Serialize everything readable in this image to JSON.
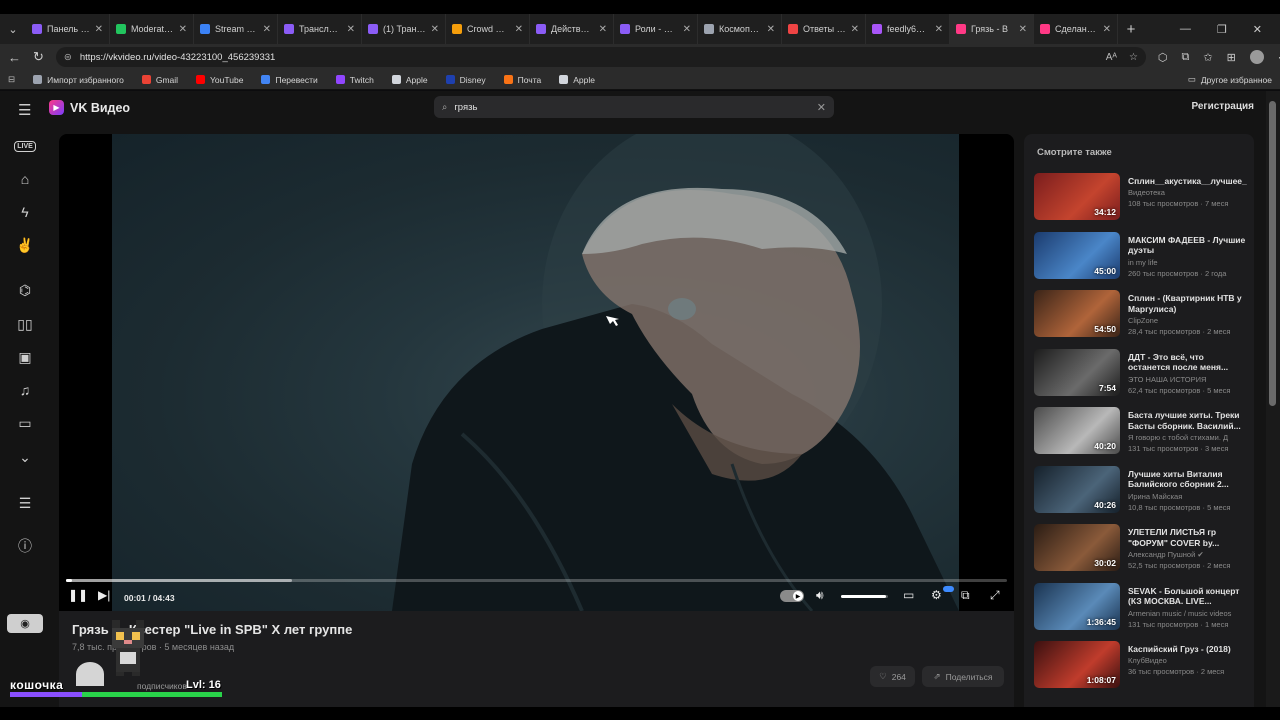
{
  "browser": {
    "tabs": [
      {
        "label": "Панель упра",
        "color": "#8b5cf6"
      },
      {
        "label": "Moderator - ",
        "color": "#22c55e"
      },
      {
        "label": "Stream via R",
        "color": "#3b82f6"
      },
      {
        "label": "Трансляция",
        "color": "#8b5cf6"
      },
      {
        "label": "(1) Трансля",
        "color": "#8b5cf6"
      },
      {
        "label": "Crowd Contr",
        "color": "#f59e0b"
      },
      {
        "label": "Действия - T",
        "color": "#8b5cf6"
      },
      {
        "label": "Роли - Twitch",
        "color": "#8b5cf6"
      },
      {
        "label": "Космопорт |",
        "color": "#9ca3af"
      },
      {
        "label": "Ответы на во",
        "color": "#ef4444"
      },
      {
        "label": "feedly66 — в",
        "color": "#a855f7"
      },
      {
        "label": "Грязь - В",
        "color": "#ff3985"
      },
      {
        "label": "Сделано в Б",
        "color": "#ff3985"
      }
    ],
    "active_tab": 11,
    "url": "https://vkvideo.ru/video-43223100_456239331",
    "bookmarks": [
      {
        "label": "Импорт избранного",
        "color": "#9ca3af"
      },
      {
        "label": "Gmail",
        "color": "#ea4335"
      },
      {
        "label": "YouTube",
        "color": "#ff0000"
      },
      {
        "label": "Перевести",
        "color": "#4285f4"
      },
      {
        "label": "Twitch",
        "color": "#9146ff"
      },
      {
        "label": "Apple",
        "color": "#d1d5db"
      },
      {
        "label": "Disney",
        "color": "#1e40af"
      },
      {
        "label": "Почта",
        "color": "#f97316"
      },
      {
        "label": "Apple",
        "color": "#d1d5db"
      }
    ],
    "bookmarks_other": "Другое избранное"
  },
  "app": {
    "logo": "VK Видео",
    "search_value": "грязь",
    "register": "Регистрация"
  },
  "player": {
    "time": "00:01 / 04:43",
    "progress": 0.004,
    "volume": 0.95
  },
  "video": {
    "title": "Грязь — Квестер \"Live in SPB\" X лет группе",
    "views": "7,8 тыс. просмотров",
    "ago": "5 месяцев назад",
    "subscribers": "подписчиков",
    "likes": "264",
    "share": "Поделиться"
  },
  "overlay": {
    "name": "кошочка",
    "level": "Lvl: 16",
    "xp_purple": 0.34,
    "xp_green": 0.66
  },
  "sidebar": {
    "title": "Смотрите также",
    "items": [
      {
        "title": "Сплин__акустика__лучшее_",
        "channel": "Видеотека",
        "stats": "108 тыс просмотров · 7 меся",
        "duration": "34:12",
        "c1": "#7a1d1d",
        "c2": "#c4442e"
      },
      {
        "title": "МАКСИМ ФАДЕЕВ - Лучшие дуэты",
        "channel": "in my life",
        "stats": "260 тыс просмотров · 2 года",
        "duration": "45:00",
        "c1": "#1b3b6e",
        "c2": "#4a86c8"
      },
      {
        "title": "Сплин - (Квартирник НТВ у Маргулиса)",
        "channel": "ClipZone",
        "stats": "28,4 тыс просмотров · 2 меся",
        "duration": "54:50",
        "c1": "#3a2418",
        "c2": "#b0643a"
      },
      {
        "title": "ДДТ - Это всё, что останется после меня...",
        "channel": "ЭТО НАША ИСТОРИЯ",
        "stats": "62,4 тыс просмотров · 5 меся",
        "duration": "7:54",
        "c1": "#1c1c1c",
        "c2": "#6b6b6b"
      },
      {
        "title": "Баста лучшие хиты. Треки Басты сборник. Василий...",
        "channel": "Я говорю с тобой стихами. Д",
        "stats": "131 тыс просмотров · 3 меся",
        "duration": "40:20",
        "c1": "#4a4a4a",
        "c2": "#b8b8b8"
      },
      {
        "title": "Лучшие хиты Виталия Балийского сборник 2...",
        "channel": "Ирина Майская",
        "stats": "10,8 тыс просмотров · 5 меся",
        "duration": "40:26",
        "c1": "#15202a",
        "c2": "#4b6479"
      },
      {
        "title": "УЛЕТЕЛИ ЛИСТЬЯ гр \"ФОРУМ\" COVER by...",
        "channel": "Александр Пушной ✔",
        "stats": "52,5 тыс просмотров · 2 меся",
        "duration": "30:02",
        "c1": "#2a1c14",
        "c2": "#8a5a3a"
      },
      {
        "title": "SEVAK - Большой концерт (КЗ МОСКВА. LIVE...",
        "channel": "Armenian music / music videos",
        "stats": "131 тыс просмотров · 1 меся",
        "duration": "1:36:45",
        "c1": "#1a3350",
        "c2": "#5a8ab8"
      },
      {
        "title": "Каспийский Груз - (2018)",
        "channel": "КлубВидео",
        "stats": "36 тыс просмотров · 2 меся",
        "duration": "1:08:07",
        "c1": "#3a1010",
        "c2": "#c03c2c"
      }
    ]
  }
}
